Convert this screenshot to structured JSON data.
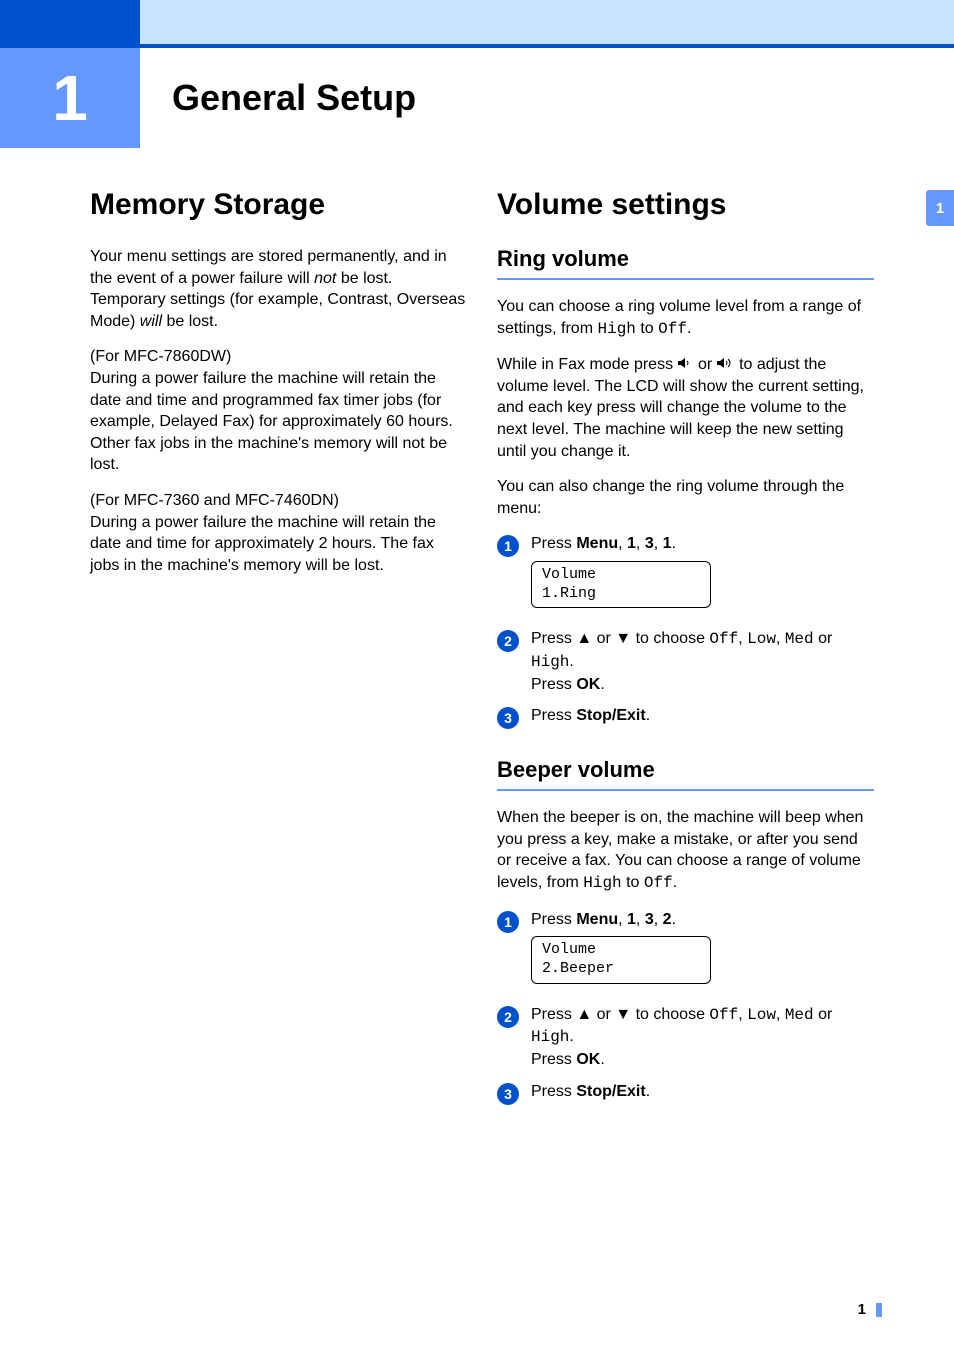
{
  "chapter": {
    "number": "1",
    "title": "General Setup"
  },
  "sidebar_tab": "1",
  "page_number": "1",
  "left": {
    "section_title": "Memory Storage",
    "p1_a": "Your menu settings are stored permanently, and in the event of a power failure will ",
    "p1_not": "not",
    "p1_b": " be lost. Temporary settings (for example, Contrast, Overseas Mode) ",
    "p1_will": "will",
    "p1_c": " be lost.",
    "p2_label": "(For MFC-7860DW)",
    "p2_body": "During a power failure the machine will retain the date and time and programmed fax timer jobs (for example, Delayed Fax) for approximately 60 hours. Other fax jobs in the machine's memory will not be lost.",
    "p3_label": "(For MFC-7360 and MFC-7460DN)",
    "p3_body": "During a power failure the machine will retain the date and time for approximately 2 hours. The fax jobs in the machine's memory will be lost."
  },
  "right": {
    "section_title": "Volume settings",
    "ring": {
      "title": "Ring volume",
      "p1_a": "You can choose a ring volume level from a range of settings, from ",
      "p1_high": "High",
      "p1_b": " to ",
      "p1_off": "Off",
      "p1_c": ".",
      "p2_a": "While in Fax mode press ",
      "p2_b": " or ",
      "p2_c": " to adjust the volume level. The LCD will show the current setting, and each key press will change the volume to the next level. The machine will keep the new setting until you change it.",
      "p3": "You can also change the ring volume through the menu:",
      "steps": {
        "s1_a": "Press ",
        "s1_menu": "Menu",
        "s1_b": ", ",
        "s1_k1": "1",
        "s1_c": ", ",
        "s1_k2": "3",
        "s1_d": ", ",
        "s1_k3": "1",
        "s1_e": ".",
        "lcd_l1": "Volume",
        "lcd_l2": "1.Ring",
        "s2_a": "Press ▲ or ▼ to choose ",
        "s2_off": "Off",
        "s2_b": ", ",
        "s2_low": "Low",
        "s2_c": ", ",
        "s2_med": "Med",
        "s2_d": " or ",
        "s2_high": "High",
        "s2_e": ".",
        "s2_press": "Press ",
        "s2_ok": "OK",
        "s2_f": ".",
        "s3_a": "Press ",
        "s3_stop": "Stop/Exit",
        "s3_b": "."
      }
    },
    "beeper": {
      "title": "Beeper volume",
      "p1_a": "When the beeper is on, the machine will beep when you press a key, make a mistake, or after you send or receive a fax. You can choose a range of volume levels, from ",
      "p1_high": "High",
      "p1_b": " to ",
      "p1_off": "Off",
      "p1_c": ".",
      "steps": {
        "s1_a": "Press ",
        "s1_menu": "Menu",
        "s1_b": ", ",
        "s1_k1": "1",
        "s1_c": ", ",
        "s1_k2": "3",
        "s1_d": ", ",
        "s1_k3": "2",
        "s1_e": ".",
        "lcd_l1": "Volume",
        "lcd_l2": "2.Beeper",
        "s2_a": "Press ▲ or ▼ to choose ",
        "s2_off": "Off",
        "s2_b": ", ",
        "s2_low": "Low",
        "s2_c": ", ",
        "s2_med": "Med",
        "s2_d": " or ",
        "s2_high": "High",
        "s2_e": ".",
        "s2_press": "Press ",
        "s2_ok": "OK",
        "s2_f": ".",
        "s3_a": "Press ",
        "s3_stop": "Stop/Exit",
        "s3_b": "."
      }
    }
  }
}
